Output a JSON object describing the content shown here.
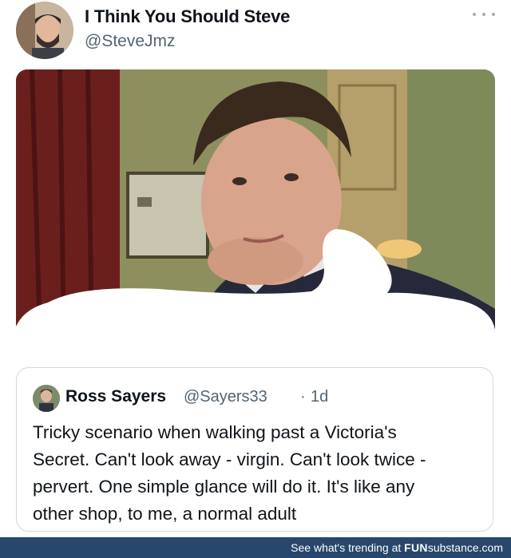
{
  "post": {
    "display_name": "I Think You Should Steve",
    "handle": "@SteveJmz",
    "more_icon": "ellipsis-icon"
  },
  "quote": {
    "display_name": "Ross Sayers",
    "handle": "@Sayers33",
    "separator": "·",
    "time": "1d",
    "lines": [
      "Tricky scenario when walking past a Victoria's",
      "Secret. Can't look away - virgin. Can't look twice -",
      "pervert. One simple glance will do it. It's like any",
      "other shop, to me, a normal adult"
    ]
  },
  "footer": {
    "prefix": "See what's trending at ",
    "brand_bold": "FUN",
    "brand_rest": "substance.com"
  },
  "colors": {
    "text_primary": "#0f1419",
    "text_secondary": "#536471",
    "card_border": "#cfd9de",
    "footer_bg": "#27476c"
  }
}
